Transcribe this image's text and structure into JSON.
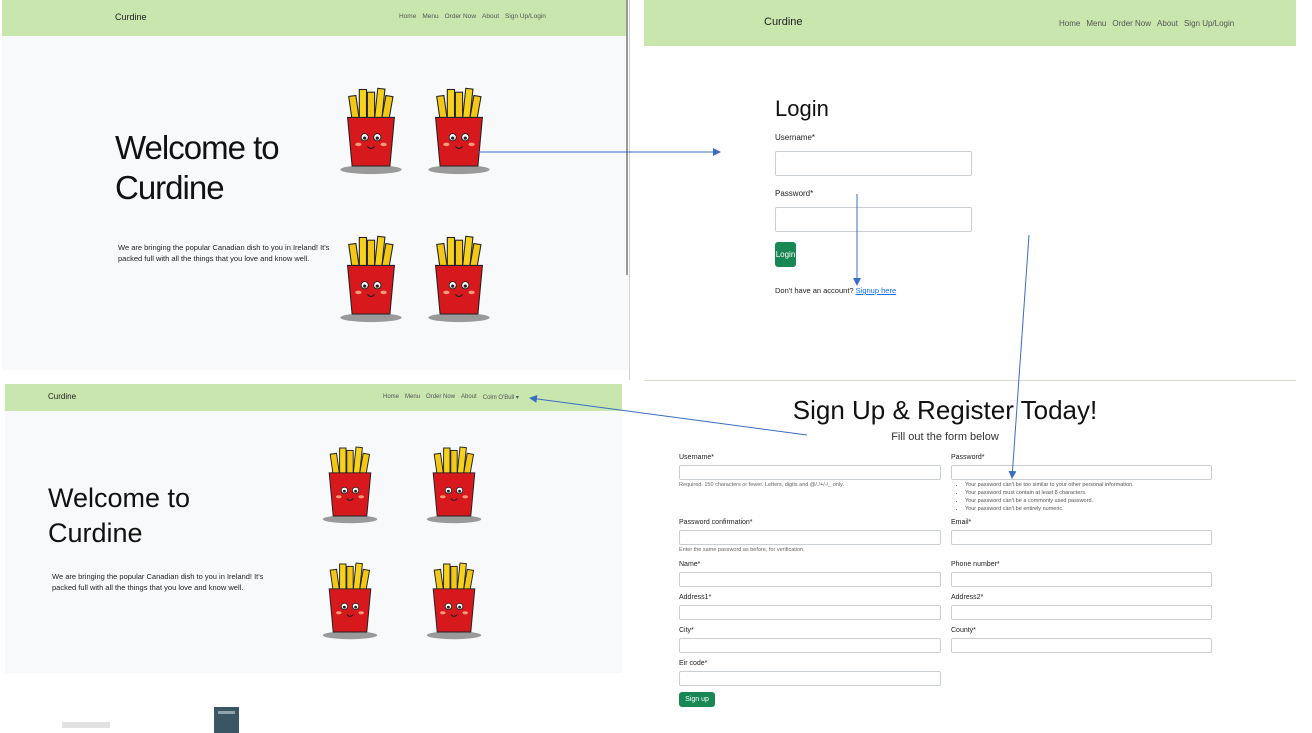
{
  "colors": {
    "navbar": "#c8e6ae",
    "hero_bg": "#f8f9fa",
    "button": "#198754",
    "arrow": "#3b6cc4",
    "fries_box": "#d7181c",
    "fries": "#f2c715"
  },
  "home_panel": {
    "brand": "Curdine",
    "nav": [
      "Home",
      "Menu",
      "Order Now",
      "About",
      "Sign Up/Login"
    ],
    "title_line1": "Welcome to",
    "title_line2": "Curdine",
    "text_line1": "We are bringing the popular Canadian dish to you in Ireland! It's",
    "text_line2": "packed full with all the things that you love and know well."
  },
  "login_panel": {
    "brand": "Curdine",
    "nav": [
      "Home",
      "Menu",
      "Order Now",
      "About",
      "Sign Up/Login"
    ],
    "heading": "Login",
    "username_label": "Username*",
    "password_label": "Password*",
    "login_button": "Login",
    "signup_prompt": "Don't have an account?",
    "signup_link": "Signup here"
  },
  "loggedin_panel": {
    "brand": "Curdine",
    "nav": [
      "Home",
      "Menu",
      "Order Now",
      "About",
      "Colm O'Bull"
    ],
    "title_line1": "Welcome to",
    "title_line2": "Curdine",
    "text_line1": "We are bringing the popular Canadian dish to you in Ireland! It's",
    "text_line2": "packed full with all the things that you love and know well."
  },
  "signup_panel": {
    "heading": "Sign Up & Register Today!",
    "subheading": "Fill out the form below",
    "username_label": "Username*",
    "username_help": "Required. 150 characters or fewer. Letters, digits and @/./+/-/_ only.",
    "password_label": "Password*",
    "password_hints": [
      "Your password can't be too similar to your other personal information.",
      "Your password must contain at least 8 characters.",
      "Your password can't be a commonly used password.",
      "Your password can't be entirely numeric."
    ],
    "password_confirm_label": "Password confirmation*",
    "password_confirm_help": "Enter the same password as before, for verification.",
    "email_label": "Email*",
    "name_label": "Name*",
    "phone_label": "Phone number*",
    "address1_label": "Address1*",
    "address2_label": "Address2*",
    "city_label": "City*",
    "county_label": "County*",
    "eircode_label": "Eir code*",
    "signup_button": "Sign up"
  }
}
